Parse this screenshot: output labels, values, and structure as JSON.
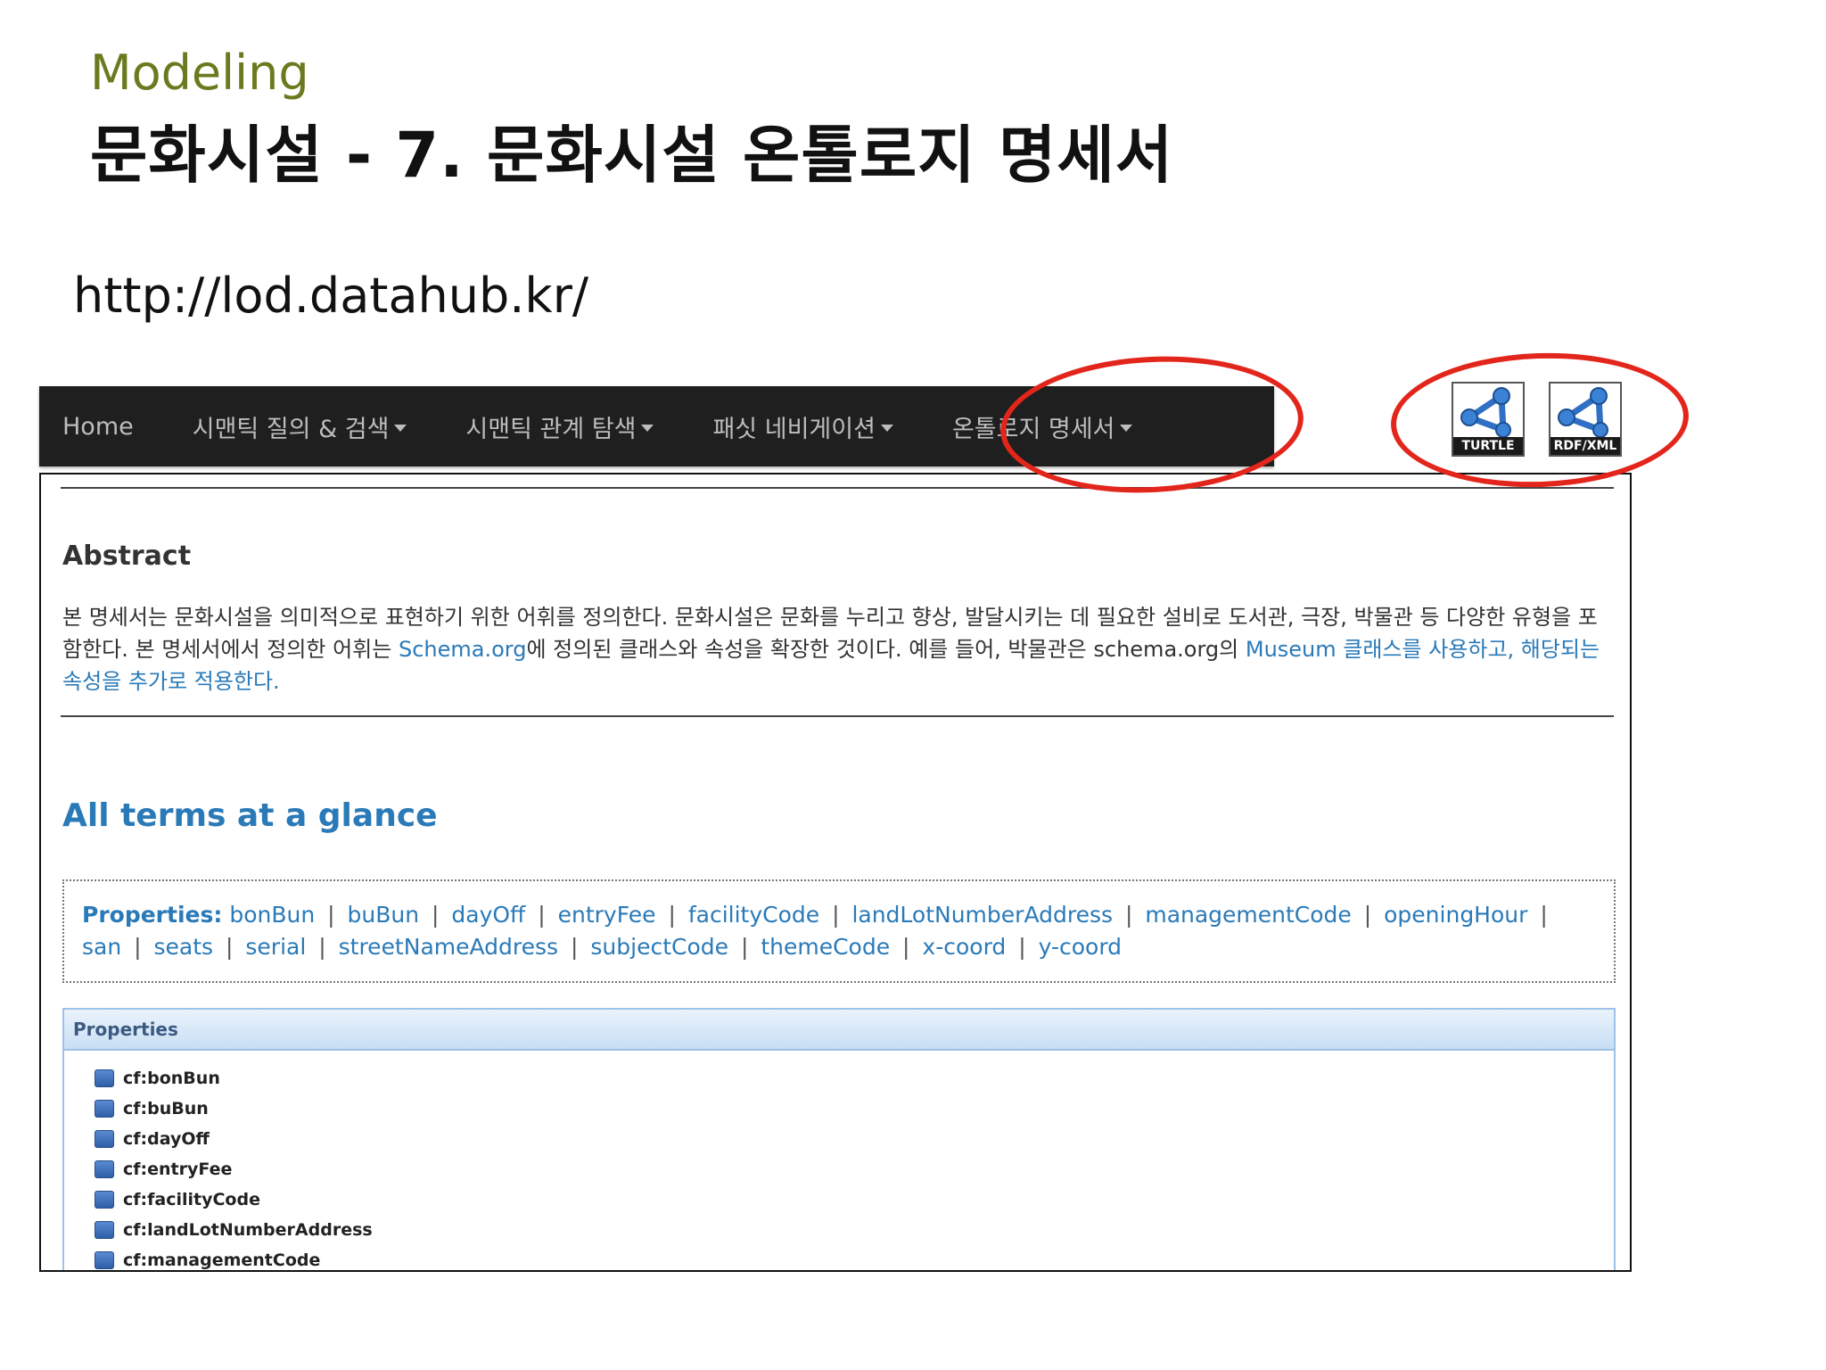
{
  "slide": {
    "subtitle": "Modeling",
    "title": "문화시설 - 7. 문화시설 온톨로지 명세서",
    "url": "http://lod.datahub.kr/"
  },
  "navbar": {
    "items": [
      {
        "label": "Home",
        "has_caret": false
      },
      {
        "label": "시맨틱 질의 & 검색",
        "has_caret": true
      },
      {
        "label": "시맨틱 관계 탐색",
        "has_caret": true
      },
      {
        "label": "패싯 네비게이션",
        "has_caret": true
      },
      {
        "label": "온톨로지 명세서",
        "has_caret": true
      }
    ]
  },
  "export": {
    "turtle_label": "TURTLE",
    "rdfxml_label": "RDF/XML"
  },
  "abstract": {
    "heading": "Abstract",
    "text_part1": "본 명세서는 문화시설을 의미적으로 표현하기 위한 어휘를 정의한다. 문화시설은 문화를 누리고 향상, 발달시키는 데 필요한 설비로 도서관, 극장, 박물관 등 다양한 유형을 포함한다. 본 명세서에서 정의한 어휘는 ",
    "link1": "Schema.org",
    "text_part2": "에 정의된 클래스와 속성을 확장한 것이다. 예를 들어, 박물관은 schema.org의 ",
    "link2": "Museum 클래스를 사용하고, 해당되는 속성을 추가로 적용한다."
  },
  "glance": {
    "heading": "All terms at a glance",
    "label": "Properties:",
    "terms": [
      "bonBun",
      "buBun",
      "dayOff",
      "entryFee",
      "facilityCode",
      "landLotNumberAddress",
      "managementCode",
      "openingHour",
      "san",
      "seats",
      "serial",
      "streetNameAddress",
      "subjectCode",
      "themeCode",
      "x-coord",
      "y-coord"
    ]
  },
  "properties": {
    "header": "Properties",
    "items": [
      "cf:bonBun",
      "cf:buBun",
      "cf:dayOff",
      "cf:entryFee",
      "cf:facilityCode",
      "cf:landLotNumberAddress",
      "cf:managementCode"
    ]
  },
  "colors": {
    "accent": "#2a7ab8",
    "subtitle": "#6b7a1e",
    "navbar_bg": "#1f1f1f",
    "highlight_ring": "#e3261c"
  }
}
